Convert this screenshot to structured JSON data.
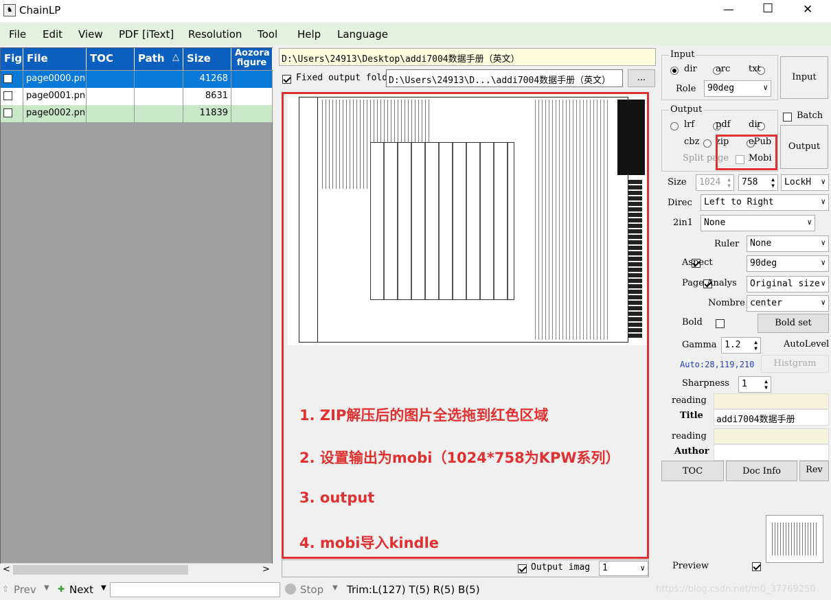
{
  "window": {
    "title": "ChainLP",
    "minimize": "—",
    "maximize": "☐",
    "close": "✕"
  },
  "menu": [
    "File",
    "Edit",
    "View",
    "PDF [iText]",
    "Resolution",
    "Tool",
    "Help",
    "Language"
  ],
  "grid": {
    "headers": [
      "Fig",
      "File",
      "TOC",
      "Path",
      "Size",
      "Aozora figure"
    ],
    "sort_indicator": "△",
    "rows": [
      {
        "file": "page0000.png",
        "size": "41268"
      },
      {
        "file": "page0001.png",
        "size": "8631"
      },
      {
        "file": "page0002.png",
        "size": "11839"
      }
    ]
  },
  "bottom": {
    "prev": "Prev",
    "next": "Next",
    "stop": "Stop",
    "trim": "Trim:L(127) T(5) R(5) B(5)"
  },
  "paths": {
    "input": "D:\\Users\\24913\\Desktop\\addi7004数据手册（英文）",
    "fixed_label": "Fixed output fold",
    "output": "D:\\Users\\24913\\D...\\addi7004数据手册（英文）",
    "browse": "..."
  },
  "instructions": [
    "1. ZIP解压后的图片全选拖到红色区域",
    "2. 设置输出为mobi（1024*758为KPW系列）",
    "3. output",
    "4. mobi导入kindle"
  ],
  "preview_bar": {
    "output_image": "Output imag",
    "output_image_value": "1",
    "preview": "Preview"
  },
  "input_group": {
    "legend": "Input",
    "dir": "dir",
    "arc": "arc",
    "txt": "txt",
    "role_label": "Role",
    "role_value": "90deg",
    "button": "Input"
  },
  "output_group": {
    "legend": "Output",
    "lrf": "lrf",
    "pdf": "pdf",
    "dir": "dir",
    "cbz": "cbz",
    "zip": "zip",
    "epub": "ePub",
    "split": "Split page",
    "mobi": "Mobi",
    "batch": "Batch",
    "button": "Output"
  },
  "settings": {
    "size_label": "Size",
    "width": "1024",
    "height": "758",
    "lock": "LockH",
    "direc_label": "Direc",
    "direc_value": "Left to Right",
    "twoin1_label": "2in1",
    "twoin1_value": "None",
    "ruler_label": "Ruler",
    "ruler_value": "None",
    "aspect_label": "Aspect",
    "aspect_value": "90deg",
    "page_label": "Page Analys",
    "page_value": "Original size",
    "nombre_label": "Nombre",
    "nombre_value": "center",
    "bold_label": "Bold",
    "bold_button": "Bold set",
    "gamma_label": "Gamma",
    "gamma_value": "1.2",
    "autolevel": "AutoLevel",
    "auto_text": "Auto:28,119,210",
    "histgram": "Histgram",
    "sharpness_label": "Sharpness",
    "sharpness_value": "1",
    "reading1": "reading",
    "title_label": "Title",
    "title_value": "addi7004数据手册",
    "reading2": "reading",
    "author_label": "Author",
    "toc": "TOC",
    "docinfo": "Doc Info",
    "rev": "Rev"
  },
  "watermark": "https://blog.csdn.net/m0_37769250",
  "colors": {
    "accent": "#0a5fbf",
    "red": "#e03030",
    "menubar": "#e5f0e0",
    "selected": "#0a78d7",
    "rowgreen": "#c8e8c8"
  }
}
